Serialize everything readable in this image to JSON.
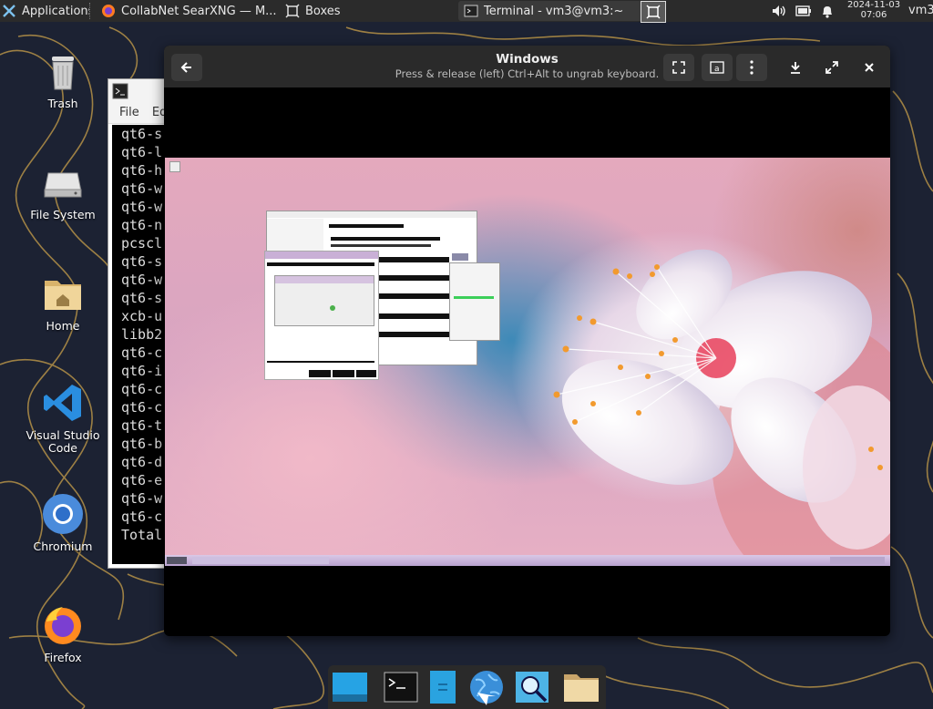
{
  "panel": {
    "apps_label": "Applications",
    "tasks": [
      {
        "label": "CollabNet SearXNG — M...",
        "icon": "firefox-icon"
      },
      {
        "label": "Boxes",
        "icon": "boxes-icon"
      },
      {
        "label": "Terminal - vm3@vm3:~",
        "icon": "terminal-icon"
      }
    ],
    "clock_date": "2024-11-03",
    "clock_time": "07:06",
    "user": "vm3"
  },
  "desktop": {
    "icons": [
      {
        "label": "Trash",
        "icon": "trash-icon"
      },
      {
        "label": "File System",
        "icon": "drive-icon"
      },
      {
        "label": "Home",
        "icon": "home-folder-icon"
      },
      {
        "label": "Visual Studio Code",
        "icon": "vscode-icon"
      },
      {
        "label": "Chromium",
        "icon": "chromium-icon"
      },
      {
        "label": "Firefox",
        "icon": "firefox-icon"
      }
    ]
  },
  "terminal": {
    "menu": [
      "File",
      "Ed"
    ],
    "lines": [
      "qt6-s",
      "qt6-l",
      "qt6-h",
      "qt6-w",
      "qt6-w",
      "qt6-n",
      "pcscl",
      "qt6-s",
      "qt6-w",
      "qt6-s",
      "xcb-u",
      "libb2",
      "qt6-c",
      "qt6-i",
      "qt6-c",
      "qt6-c",
      "qt6-t",
      "qt6-b",
      "qt6-d",
      "qt6-e",
      "qt6-w",
      "qt6-c",
      "Total"
    ]
  },
  "boxes": {
    "title": "Windows",
    "subtitle": "Press & release (left) Ctrl+Alt to ungrab keyboard."
  },
  "dock": {
    "items": [
      "desktop-icon",
      "terminal-icon",
      "text-editor-icon",
      "web-browser-icon",
      "app-finder-icon",
      "files-icon"
    ]
  },
  "colors": {
    "panel": "#2b2b2b",
    "accent": "#3b8fd6"
  }
}
